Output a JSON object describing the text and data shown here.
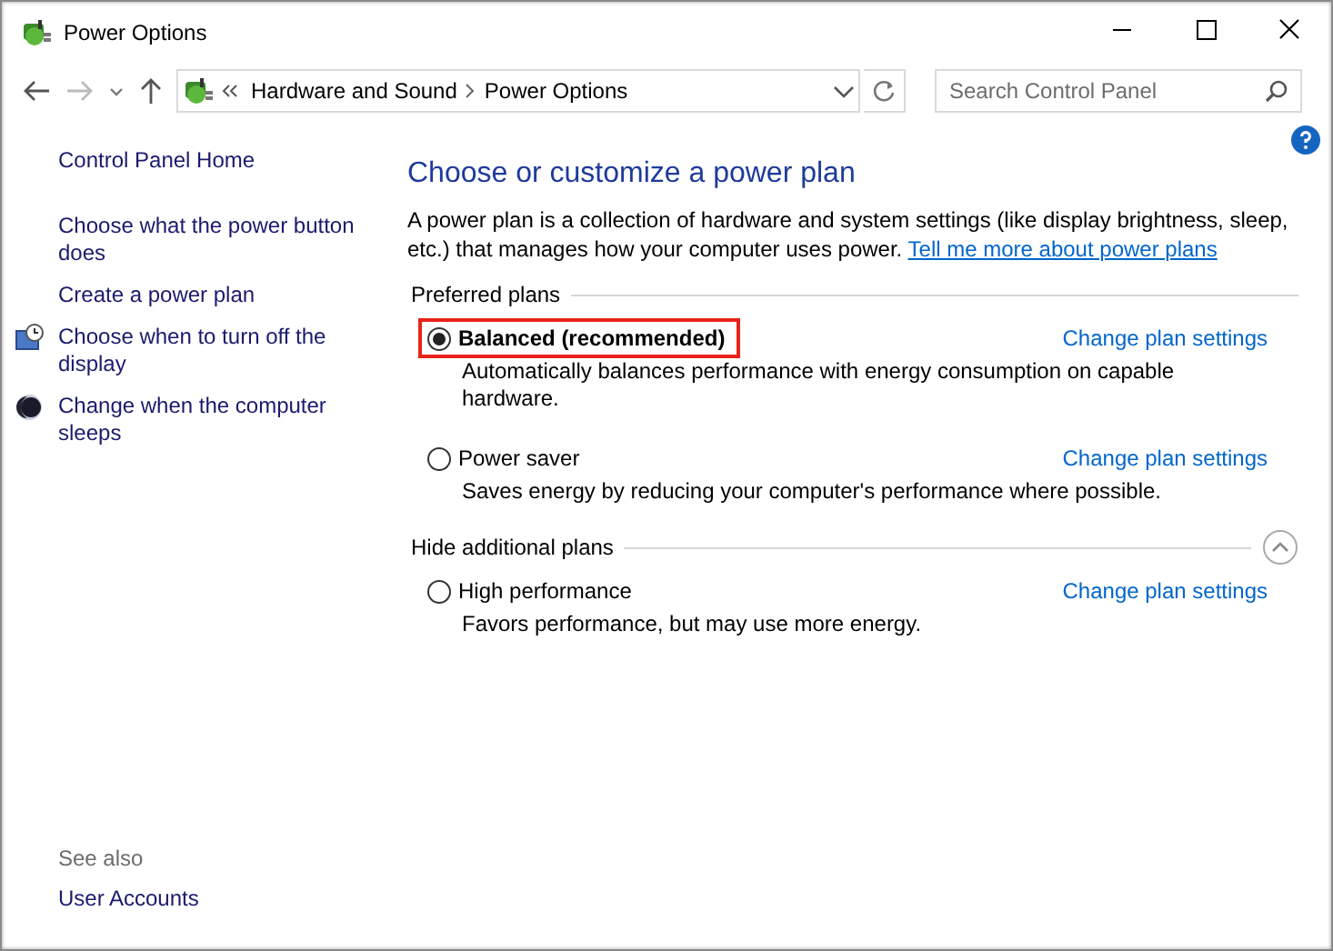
{
  "window": {
    "title": "Power Options"
  },
  "nav": {
    "breadcrumbs": [
      "Hardware and Sound",
      "Power Options"
    ],
    "search": {
      "placeholder": "Search Control Panel"
    }
  },
  "sidebar": {
    "home": "Control Panel Home",
    "items": [
      {
        "label": "Choose what the power button does",
        "kind": "plain"
      },
      {
        "label": "Create a power plan",
        "kind": "plain"
      },
      {
        "label": "Choose when to turn off the display",
        "kind": "display"
      },
      {
        "label": "Change when the computer sleeps",
        "kind": "sleep"
      }
    ],
    "see_also": {
      "heading": "See also",
      "links": [
        "User Accounts"
      ]
    }
  },
  "main": {
    "title": "Choose or customize a power plan",
    "description": "A power plan is a collection of hardware and system settings (like display brightness, sleep, etc.) that manages how your computer uses power.",
    "link": "Tell me more about power plans",
    "sections": [
      {
        "heading": "Preferred plans",
        "collapsible": false,
        "plans": [
          {
            "name": "Balanced (recommended)",
            "selected": true,
            "highlighted": true,
            "description": "Automatically balances performance with energy consumption on capable hardware.",
            "action": "Change plan settings"
          },
          {
            "name": "Power saver",
            "selected": false,
            "highlighted": false,
            "description": "Saves energy by reducing your computer's performance where possible.",
            "action": "Change plan settings"
          }
        ]
      },
      {
        "heading": "Hide additional plans",
        "collapsible": true,
        "plans": [
          {
            "name": "High performance",
            "selected": false,
            "highlighted": false,
            "description": "Favors performance, but may use more energy.",
            "action": "Change plan settings"
          }
        ]
      }
    ]
  }
}
